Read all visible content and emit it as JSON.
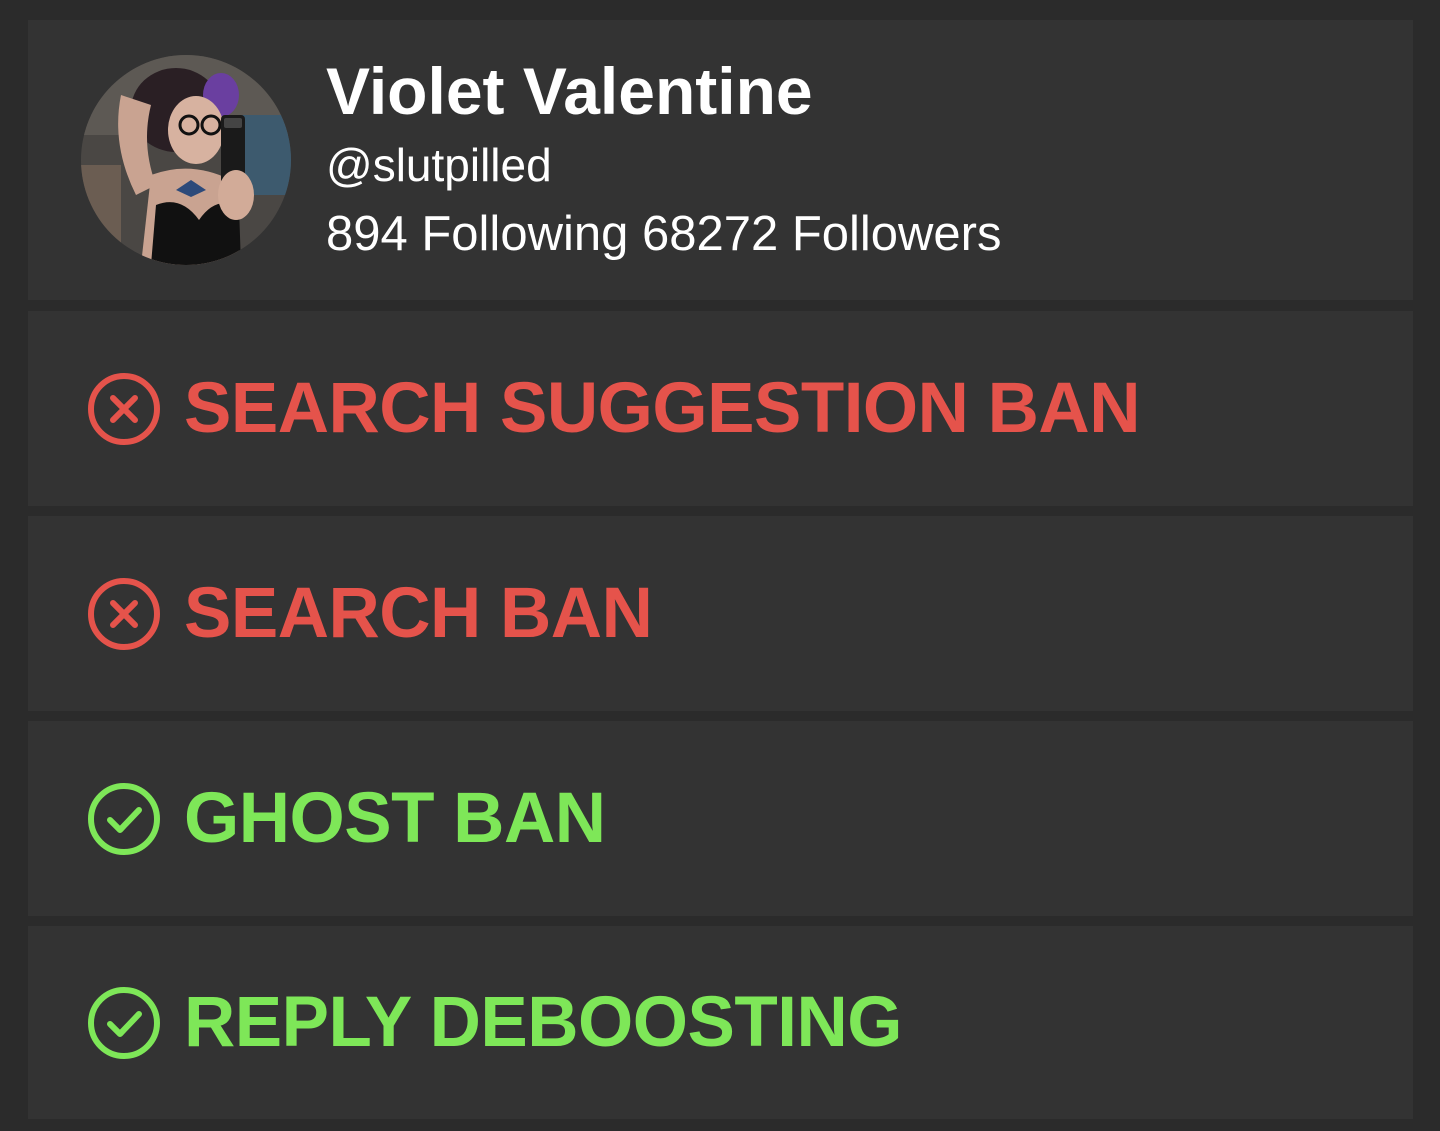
{
  "colors": {
    "page_background": "#2b2b2b",
    "card_background": "#333333",
    "banned": "#e5534b",
    "clear": "#7ee758",
    "text": "#ffffff"
  },
  "profile": {
    "display_name": "Violet Valentine",
    "handle": "@slutpilled",
    "stats": "894 Following 68272 Followers",
    "avatar": "profile-photo"
  },
  "checks": [
    {
      "label": "SEARCH SUGGESTION BAN",
      "status": "banned",
      "icon": "x-circle-icon"
    },
    {
      "label": "SEARCH BAN",
      "status": "banned",
      "icon": "x-circle-icon"
    },
    {
      "label": "GHOST BAN",
      "status": "clear",
      "icon": "check-circle-icon"
    },
    {
      "label": "REPLY DEBOOSTING",
      "status": "clear",
      "icon": "check-circle-icon"
    }
  ]
}
